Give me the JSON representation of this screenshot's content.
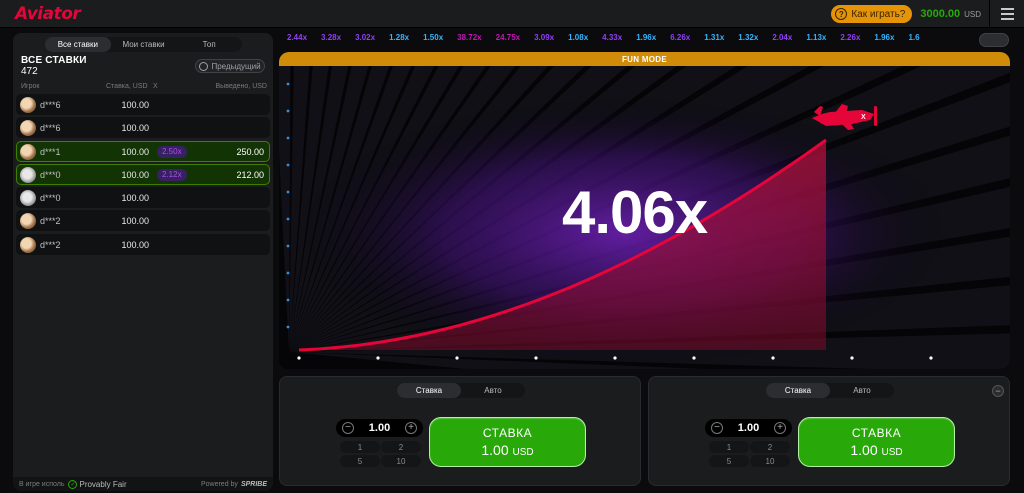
{
  "header": {
    "logo": "Aviator",
    "howto_label": "Как играть?",
    "howto_icon": "question-icon",
    "balance": "3000.00",
    "currency": "USD"
  },
  "left": {
    "tabs": [
      "Все ставки",
      "Мои ставки",
      "Топ"
    ],
    "title": "ВСЕ СТАВКИ",
    "count": "472",
    "prev_button": "Предыдущий",
    "columns": {
      "player": "Игрок",
      "stake": "Ставка, USD",
      "x": "X",
      "win": "Выведено, USD"
    },
    "rows": [
      {
        "user": "d***6",
        "stake": "100.00",
        "mult": "",
        "win": "",
        "won": false,
        "avatar": "tan"
      },
      {
        "user": "d***6",
        "stake": "100.00",
        "mult": "",
        "win": "",
        "won": false,
        "avatar": "tan"
      },
      {
        "user": "d***1",
        "stake": "100.00",
        "mult": "2.50x",
        "win": "250.00",
        "won": true,
        "avatar": "tan"
      },
      {
        "user": "d***0",
        "stake": "100.00",
        "mult": "2.12x",
        "win": "212.00",
        "won": true,
        "avatar": "grey"
      },
      {
        "user": "d***0",
        "stake": "100.00",
        "mult": "",
        "win": "",
        "won": false,
        "avatar": "grey"
      },
      {
        "user": "d***2",
        "stake": "100.00",
        "mult": "",
        "win": "",
        "won": false,
        "avatar": "tan"
      },
      {
        "user": "d***2",
        "stake": "100.00",
        "mult": "",
        "win": "",
        "won": false,
        "avatar": "tan"
      }
    ],
    "footer_left": "В игре исполь",
    "provably_fair": "Provably Fair",
    "powered_by": "Powered by",
    "powered_brand": "SPRIBE"
  },
  "history": [
    {
      "v": "2.44x",
      "c": "#913ef8"
    },
    {
      "v": "3.28x",
      "c": "#913ef8"
    },
    {
      "v": "3.02x",
      "c": "#913ef8"
    },
    {
      "v": "1.28x",
      "c": "#34b4ff"
    },
    {
      "v": "1.50x",
      "c": "#34b4ff"
    },
    {
      "v": "38.72x",
      "c": "#c017b4"
    },
    {
      "v": "24.75x",
      "c": "#c017b4"
    },
    {
      "v": "3.09x",
      "c": "#913ef8"
    },
    {
      "v": "1.08x",
      "c": "#34b4ff"
    },
    {
      "v": "4.33x",
      "c": "#913ef8"
    },
    {
      "v": "1.96x",
      "c": "#34b4ff"
    },
    {
      "v": "6.26x",
      "c": "#913ef8"
    },
    {
      "v": "1.31x",
      "c": "#34b4ff"
    },
    {
      "v": "1.32x",
      "c": "#34b4ff"
    },
    {
      "v": "2.04x",
      "c": "#913ef8"
    },
    {
      "v": "1.13x",
      "c": "#34b4ff"
    },
    {
      "v": "2.26x",
      "c": "#913ef8"
    },
    {
      "v": "1.96x",
      "c": "#34b4ff"
    },
    {
      "v": "1.6",
      "c": "#34b4ff"
    }
  ],
  "game": {
    "mode_banner": "FUN MODE",
    "multiplier": "4.06x"
  },
  "bets": [
    {
      "tab_bet": "Ставка",
      "tab_auto": "Авто",
      "amount": "1.00",
      "quick": [
        "1",
        "2",
        "5",
        "10"
      ],
      "button_label": "СТАВКА",
      "button_amount": "1.00",
      "button_currency": "USD"
    },
    {
      "tab_bet": "Ставка",
      "tab_auto": "Авто",
      "amount": "1.00",
      "quick": [
        "1",
        "2",
        "5",
        "10"
      ],
      "button_label": "СТАВКА",
      "button_amount": "1.00",
      "button_currency": "USD"
    }
  ],
  "colors": {
    "brand_red": "#e50539",
    "green": "#28a909",
    "orange": "#d08b08",
    "purple": "#913ef8",
    "blue": "#34b4ff",
    "pink": "#c017b4"
  }
}
